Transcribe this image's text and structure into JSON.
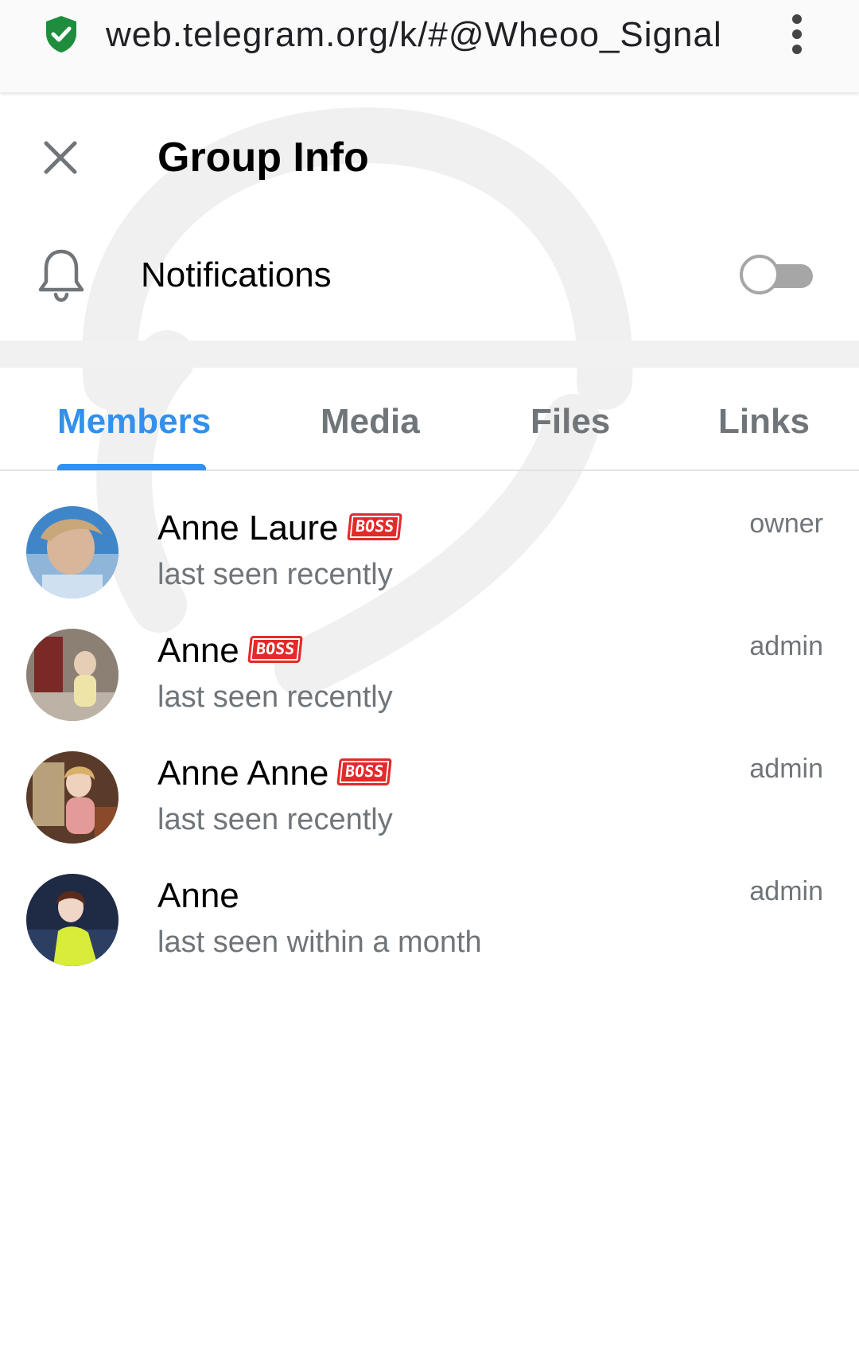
{
  "browser": {
    "url": "web.telegram.org/k/#@Wheoo_Signal",
    "shield_icon": "shield-check-icon",
    "menu_icon": "vertical-dots-icon"
  },
  "header": {
    "title": "Group Info",
    "close_icon": "close-icon"
  },
  "notifications": {
    "label": "Notifications",
    "icon": "bell-icon",
    "enabled": false
  },
  "tabs": [
    {
      "label": "Members",
      "active": true
    },
    {
      "label": "Media",
      "active": false
    },
    {
      "label": "Files",
      "active": false
    },
    {
      "label": "Links",
      "active": false
    }
  ],
  "members": [
    {
      "name": "Anne Laure",
      "badge": "BOSS",
      "status": "last seen recently",
      "role": "owner"
    },
    {
      "name": "Anne",
      "badge": "BOSS",
      "status": "last seen recently",
      "role": "admin"
    },
    {
      "name": "Anne Anne",
      "badge": "BOSS",
      "status": "last seen recently",
      "role": "admin"
    },
    {
      "name": "Anne",
      "badge": "",
      "status": "last seen within a month",
      "role": "admin"
    }
  ],
  "colors": {
    "accent": "#3390ec",
    "secondary_text": "#707579",
    "shield": "#1e8e3e",
    "badge": "#e32a2a"
  }
}
